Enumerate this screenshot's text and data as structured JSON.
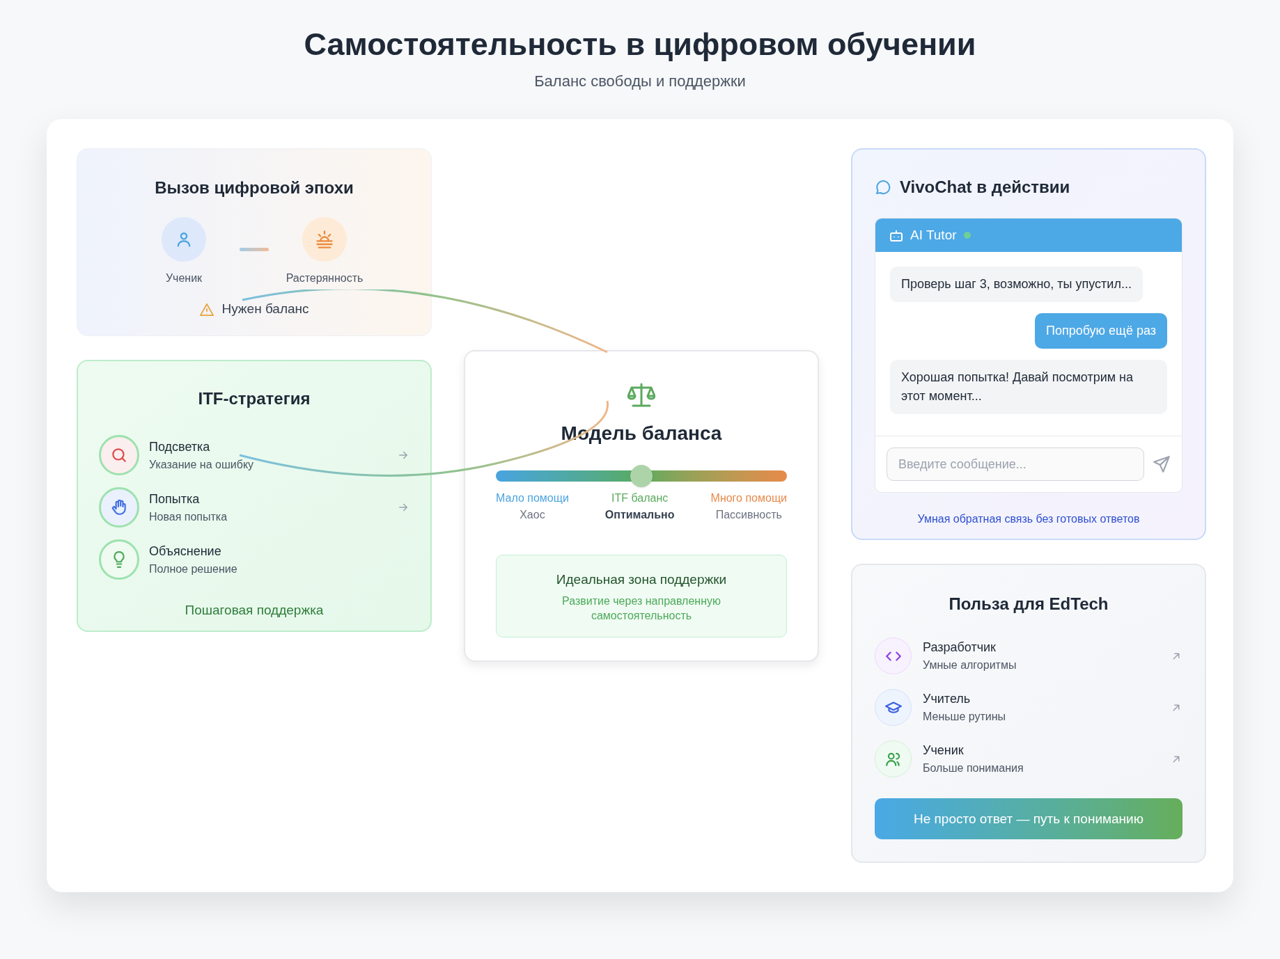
{
  "title": "Самостоятельность в цифровом обучении",
  "subtitle": "Баланс свободы и поддержки",
  "challenge": {
    "title": "Вызов цифровой эпохи",
    "items": [
      {
        "label": "Ученик",
        "kind": "student"
      },
      {
        "label": "Растерянность",
        "kind": "confusion"
      }
    ],
    "warning": "Нужен баланс"
  },
  "itf": {
    "title": "ITF-стратегия",
    "steps": [
      {
        "title": "Подсветка",
        "subtitle": "Указание на ошибку",
        "kind": "highlight"
      },
      {
        "title": "Попытка",
        "subtitle": "Новая попытка",
        "kind": "attempt"
      },
      {
        "title": "Объяснение",
        "subtitle": "Полное решение",
        "kind": "explanation"
      }
    ],
    "footer": "Пошаговая поддержка"
  },
  "balance_model": {
    "title": "Модель баланса",
    "slider": {
      "level": 0.5
    },
    "zones": [
      {
        "label": "Мало помощи",
        "state": "Хаос",
        "color": "#4aa3df",
        "emphasized": false
      },
      {
        "label": "ITF баланс",
        "state": "Оптимально",
        "color": "#5aaa5e",
        "emphasized": true
      },
      {
        "label": "Много помощи",
        "state": "Пассивность",
        "color": "#e8894a",
        "emphasized": false
      }
    ],
    "ideal": {
      "title": "Идеальная зона поддержки",
      "text": "Развитие через направленную самостоятельность"
    }
  },
  "chat": {
    "title": "VivoChat в действии",
    "bot_name": "AI Tutor",
    "online": true,
    "messages": [
      {
        "kind": "incoming",
        "text": "Проверь шаг 3, возможно, ты упустил..."
      },
      {
        "kind": "outgoing",
        "text": "Попробую ещё раз"
      },
      {
        "kind": "incoming",
        "text": "Хорошая попытка! Давай посмотрим на этот момент..."
      }
    ],
    "input": {
      "placeholder": "Введите сообщение..."
    },
    "footer": "Умная обратная связь без готовых ответов"
  },
  "benefits": {
    "title": "Польза для EdTech",
    "items": [
      {
        "title": "Разработчик",
        "subtitle": "Умные алгоритмы",
        "kind": "developer"
      },
      {
        "title": "Учитель",
        "subtitle": "Меньше рутины",
        "kind": "teacher"
      },
      {
        "title": "Ученик",
        "subtitle": "Больше понимания",
        "kind": "student"
      }
    ],
    "cta": "Не просто ответ — путь к пониманию"
  }
}
